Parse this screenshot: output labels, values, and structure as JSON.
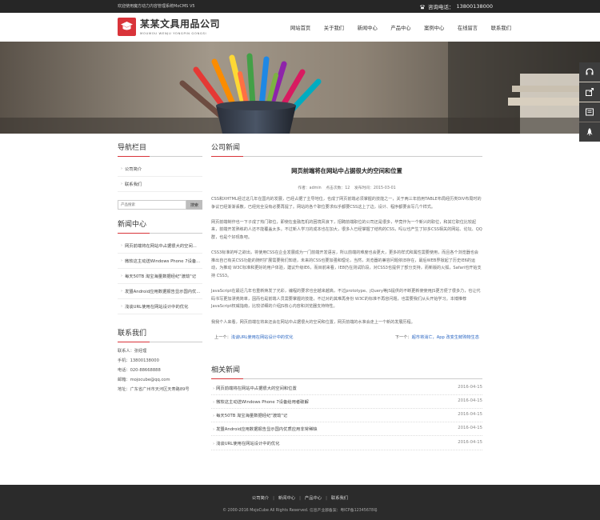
{
  "topbar": {
    "welcome": "欢迎使用魔方动力内容管理系统MoCMS V5",
    "phone_label": "咨询电话：",
    "phone": "13800138000"
  },
  "logo": {
    "name": "某某文具用品公司",
    "en": "MOUMOU WENJU YONGPIN GONGSI"
  },
  "nav": [
    "网站首页",
    "关于我们",
    "新闻中心",
    "产品中心",
    "案例中心",
    "在线留言",
    "联系我们"
  ],
  "side_tools": [
    "headset-icon",
    "share-icon",
    "contact-card-icon",
    "rocket-icon"
  ],
  "sidebar": {
    "nav_title": "导航栏目",
    "nav_items": [
      "公司简介",
      "联系我们"
    ],
    "search_placeholder": "产品搜索",
    "search_button": "搜索",
    "news_title": "新闻中心",
    "news_items": [
      "网页前端将在网站中占据很大的空间...",
      "微软这主动送Windows Phone 7设备...",
      "每天50TB 淘宝海量数据经纪\"渡劫\"记",
      "发盟Android应用数据报告显示国内优...",
      "浅谈URL使用在网站设计中的优化"
    ],
    "contact_title": "联系我们",
    "contact_lines": [
      "联系人：张经理",
      "手机：13800138000",
      "电话：020-88668888",
      "邮箱：mojocube@qq.com",
      "地址：广东省广州市天河区天寿路89号"
    ]
  },
  "main": {
    "section_title": "公司新闻",
    "article_title": "网页前端将在网站中占据很大的空间和位置",
    "meta_author": "作者：admin",
    "meta_clicks": "点击次数：12",
    "meta_date": "发布时间：2015-03-01",
    "paragraphs": [
      "CSS和XHTML经过这几年在国内的发展，已经占据了主导地位，也成了网页前端必须掌握的技能之一，关于两三年前用TABLE布局经历类DIV布局时的争议已经渐渐丢散，已经完全没有必要再提了。网站的各个职位要求似乎都要CSS这上了边，设计、程序都要会写几个样式。",
      "网页前端制作也一下子成了热门职位，即使在金融危机的困境风浪下，招聘前端职位的公司还是很多，毕竟作为一个新兴的职位，和其它职位比较起来，前端开发熟练的人还不能覆盖太多。不过新人学习的成本也在加大，很多人已经掌握了结构的CSS，吗以也产生了好多CSS相关的网站、论坛、QQ群，也是个好现象吧。",
      "CSS3标准的呼之欲出，将使用CSS在企业发展成为一门前端开发语言，所以前端的难度也会更大，更多的样式和属性需要使用，而且各个浏览器也会推出自己有关CSS功能的随时扩展需要我们知道，未来的CSS也要加强和理论，当然，浏览器的兼容问题依旧存在，最后WEB界掀起了历史IE6的运动，为推动 W3C标准和更好的用户体验，建议升级IE6，而目前来看，IE8仍在测试阶段，对CSS3也提供了部分支持，而新版的火狐，Safari也开始支持 CSS3。",
      "JavaScript在最近几年也重新焕发了光彩，编程的要求也全越来越高，不过prototype、jQuery等JS提供的不断更新使使用JS更方便了很多力，也让代码书写更加漂亮简单，因而也是前端人员需要掌握的技能，不过对的其难再身份 W3C的标准不再容问题，也需要我们从头开始学习。本博推荐JavaScript权威指南，比较详细的介绍JS核心内容和浏览器支持特性。",
      "我我个人来看，网页前端在将来还会在网站中占据很大的空间和位置，网页前端的水准会走上一个新的发展历程。"
    ],
    "prev_label": "上一个：",
    "prev_link": "浅谈URL使用在网站设计中的优化",
    "next_label": "下一个：",
    "next_link": "超市将消亡，App 改变生鲜购物生态",
    "related_title": "相关新闻",
    "related": [
      {
        "title": "网页前端将在网站中占据很大的空间和位置",
        "date": "2016-04-15"
      },
      {
        "title": "微软这主动送Windows Phone 7设备给用者破解",
        "date": "2016-04-15"
      },
      {
        "title": "每天50TB 淘宝海量数据经纪\"渡劫\"记",
        "date": "2016-04-15"
      },
      {
        "title": "发盟Android应用数据报告显示国内优质应用非常稀缺",
        "date": "2016-04-15"
      },
      {
        "title": "浅谈URL使用在网站设计中的优化",
        "date": "2016-04-15"
      }
    ]
  },
  "footer": {
    "links": [
      "公司简介",
      "新闻中心",
      "产品中心",
      "联系我们"
    ],
    "copyright": "© 2000-2016 MojoCube All Rights Reserved. 信息产业部备案：粤ICP备12345678号"
  },
  "colors": {
    "accent": "#d9343a",
    "topbar": "#262626",
    "footer": "#2b2b2b",
    "link": "#2a66c2"
  }
}
